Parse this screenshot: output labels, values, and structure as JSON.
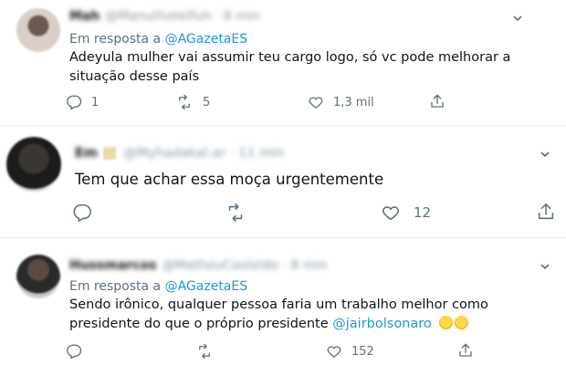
{
  "tweets": [
    {
      "name": "Mah",
      "handle": "@Manuthotelfuh · 8 min",
      "reply_prefix": "Em resposta a",
      "reply_to": "@AGazetaES",
      "text": "Adeyula mulher vai assumir teu cargo logo, só vc pode melhorar a situação desse país",
      "reply_count": "1",
      "retweet_count": "5",
      "like_count": "1,3 mil"
    },
    {
      "name": "Em",
      "handle": "@Myhadakal.ar · 11 min",
      "text": "Tem que achar essa moça urgentemente",
      "like_count": "12"
    },
    {
      "name": "Hussmarcos",
      "handle": "@MatheuCasteldo · 8 min",
      "reply_prefix": "Em resposta a",
      "reply_to": "@AGazetaES",
      "text": "Sendo irônico, qualquer pessoa faria um trabalho melhor como presidente do que o próprio presidente ",
      "mention": "@jairbolsonaro",
      "emoji": [
        "🤔",
        "🤣"
      ],
      "like_count": "152"
    }
  ],
  "icons": [
    "caret-down-icon",
    "reply-icon",
    "retweet-icon",
    "like-icon",
    "share-icon"
  ],
  "colors": {
    "link": "#1b95e0",
    "muted": "#5b7083",
    "text": "#0f1419",
    "divider": "#e6ecf0"
  }
}
